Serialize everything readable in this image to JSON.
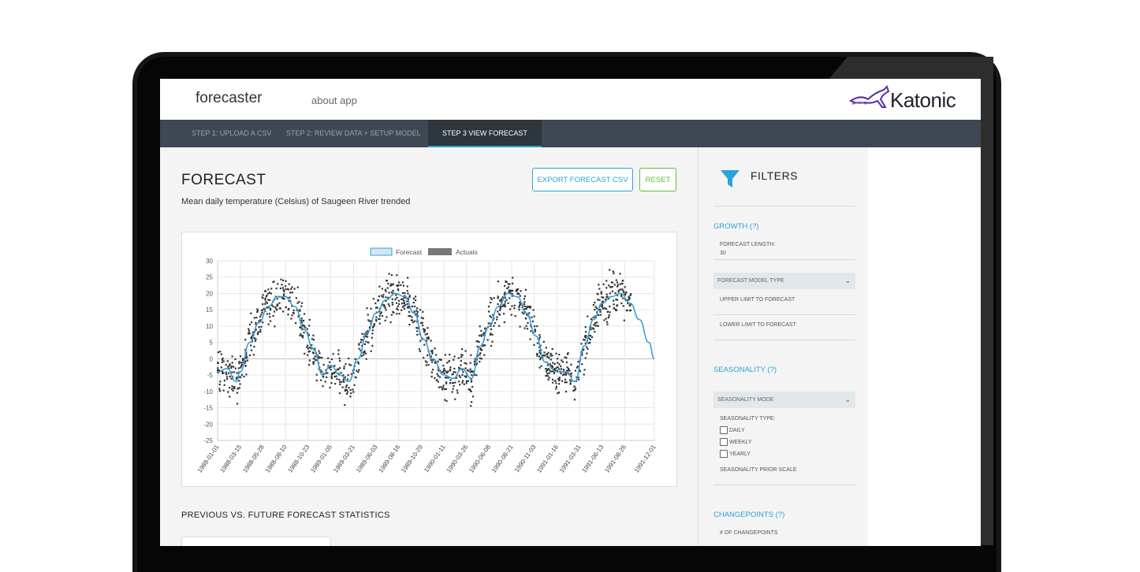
{
  "header": {
    "brand": "forecaster",
    "about_link": "about app",
    "logo_text": "Katonic"
  },
  "tabs": [
    {
      "label": "STEP 1: UPLOAD A CSV",
      "active": false
    },
    {
      "label": "STEP 2: REVIEW DATA + SETUP MODEL",
      "active": false
    },
    {
      "label": "STEP 3 VIEW FORECAST",
      "active": true
    }
  ],
  "main": {
    "title": "FORECAST",
    "subtitle": "Mean daily temperature (Celsius) of Saugeen River trended",
    "export_button": "EXPORT FORECAST CSV",
    "reset_button": "RESET",
    "stats_title": "PREVIOUS VS. FUTURE FORECAST STATISTICS"
  },
  "sidebar": {
    "title": "FILTERS",
    "growth": {
      "heading": "GROWTH (?)",
      "forecast_length_label": "FORECAST LENGTH:",
      "forecast_length_value": "30",
      "model_type_select": "FORECAST MODEL TYPE",
      "upper_limit": "UPPER LIMIT TO FORECAST",
      "lower_limit": "LOWER LIMIT TO FORECAST"
    },
    "seasonality": {
      "heading": "SEASONALITY (?)",
      "mode_select": "SEASONALITY MODE",
      "type_label": "SEASONALITY TYPE:",
      "options": [
        "DAILY",
        "WEEKLY",
        "YEARLY"
      ],
      "prior_scale": "SEASONALITY PRIOR SCALE"
    },
    "changepoints": {
      "heading": "CHANGEPOINTS (?)",
      "count_label": "# OF CHANGEPOINTS"
    }
  },
  "colors": {
    "accent": "#2aa3d8",
    "reset": "#5cbf3a",
    "tabbar": "#3e4852",
    "forecast_line": "#3a9fd6",
    "actuals": "#333333"
  },
  "chart_data": {
    "type": "scatter",
    "legend": [
      "Forecast",
      "Actuals"
    ],
    "legend_position": "top-center",
    "ylim": [
      -25,
      30
    ],
    "yticks": [
      30,
      25,
      20,
      15,
      10,
      5,
      0,
      -5,
      -10,
      -15,
      -20,
      -25
    ],
    "xticks": [
      "1988-01-01",
      "1988-03-15",
      "1988-05-28",
      "1988-08-10",
      "1988-10-23",
      "1989-01-05",
      "1989-03-21",
      "1989-06-03",
      "1989-08-16",
      "1989-10-29",
      "1990-01-11",
      "1990-03-26",
      "1990-06-08",
      "1990-08-21",
      "1990-11-03",
      "1991-01-16",
      "1991-03-31",
      "1991-06-13",
      "1991-08-26",
      "1991-12-01"
    ],
    "grid": true,
    "series": [
      {
        "name": "Forecast",
        "kind": "line",
        "x": [
          "1988-01-01",
          "1988-02-01",
          "1988-03-01",
          "1988-03-15",
          "1988-04-15",
          "1988-05-15",
          "1988-06-15",
          "1988-07-15",
          "1988-08-10",
          "1988-09-10",
          "1988-10-10",
          "1988-11-10",
          "1988-12-10",
          "1989-01-05",
          "1989-02-05",
          "1989-03-05",
          "1989-04-05",
          "1989-05-05",
          "1989-06-03",
          "1989-07-05",
          "1989-08-05",
          "1989-09-05",
          "1989-10-05",
          "1989-11-05",
          "1989-12-05",
          "1990-01-11",
          "1990-02-11",
          "1990-03-11",
          "1990-04-11",
          "1990-05-11",
          "1990-06-08",
          "1990-07-08",
          "1990-08-08",
          "1990-09-08",
          "1990-10-08",
          "1990-11-08",
          "1990-12-08",
          "1991-01-16",
          "1991-02-16",
          "1991-03-16",
          "1991-04-16",
          "1991-05-16",
          "1991-06-13",
          "1991-07-13",
          "1991-08-13",
          "1991-09-13",
          "1991-10-13",
          "1991-11-13",
          "1991-12-01"
        ],
        "y": [
          -4,
          -3,
          -7,
          -4,
          5,
          11,
          16,
          19,
          19,
          16,
          9,
          3,
          -5,
          -2,
          -5,
          -7,
          0,
          8,
          14,
          18,
          20,
          19,
          14,
          6,
          0,
          -5,
          -6,
          -3,
          -6,
          4,
          10,
          16,
          20,
          19,
          14,
          7,
          -1,
          -4,
          -4,
          -7,
          4,
          12,
          17,
          19,
          20,
          17,
          12,
          5,
          0
        ]
      }
    ]
  }
}
